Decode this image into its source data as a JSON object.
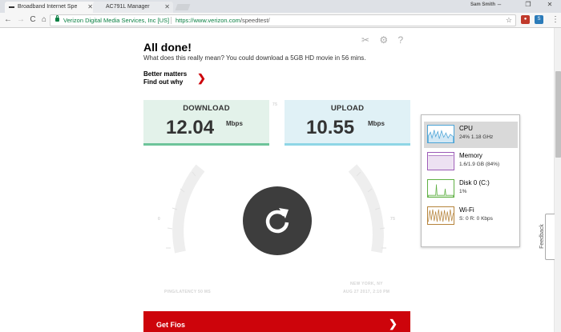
{
  "browser": {
    "tabs": [
      {
        "title": "Broadband Internet Spe",
        "active": true
      },
      {
        "title": "AC791L Manager",
        "active": false
      }
    ],
    "user": "Sam Smith",
    "window_controls": {
      "minimize": "–",
      "restore": "❐",
      "close": "✕"
    },
    "site_identity": "Verizon Digital Media Services, Inc [US]",
    "url_host": "https://www.verizon.com",
    "url_path": "/speedtest/",
    "back": "←",
    "forward": "→",
    "reload": "C",
    "home": "⌂",
    "star": "☆",
    "menu": "⋮"
  },
  "page": {
    "tool_icons": {
      "tools": "✂",
      "settings": "⚙",
      "help": "?"
    },
    "title": "All done!",
    "description": "What does this really mean? You could download a 5GB HD movie in 56 mins.",
    "better_line1": "Better matters",
    "better_line2": "Find out why",
    "chevron": "❯",
    "download": {
      "label": "DOWNLOAD",
      "value": "12.04",
      "unit": "Mbps"
    },
    "upload": {
      "label": "UPLOAD",
      "value": "10.55",
      "unit": "Mbps"
    },
    "gauge": {
      "min": "0",
      "max": "75",
      "mid": "75"
    },
    "ping_label": "PING/LATENCY 50 MS",
    "location_line1": "NEW YORK, NY",
    "location_line2": "AUG 27 2017, 2:10 PM",
    "cta": "Get Fios",
    "feedback": "Feedback"
  },
  "perf": {
    "items": [
      {
        "name": "CPU",
        "value": "24%  1.18 GHz",
        "color": "#4aa3d6",
        "selected": true
      },
      {
        "name": "Memory",
        "value": "1.6/1.9 GB (84%)",
        "color": "#9b59b6",
        "selected": false
      },
      {
        "name": "Disk 0 (C:)",
        "value": "1%",
        "color": "#5fb043",
        "selected": false
      },
      {
        "name": "Wi-Fi",
        "value": "S: 0  R: 0 Kbps",
        "color": "#b5833a",
        "selected": false
      }
    ]
  },
  "colors": {
    "verizon_red": "#cd040b",
    "download_accent": "#6dc49a",
    "upload_accent": "#8fd6e6"
  }
}
